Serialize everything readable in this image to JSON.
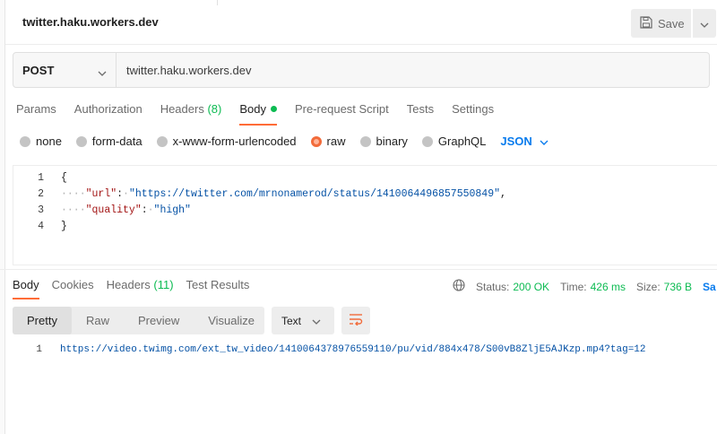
{
  "tab": {
    "title": "twitter.haku.workers.dev"
  },
  "toolbar": {
    "save_label": "Save"
  },
  "request": {
    "method": "POST",
    "url": "twitter.haku.workers.dev"
  },
  "request_tabs": {
    "params": "Params",
    "authorization": "Authorization",
    "headers": "Headers",
    "headers_count": "(8)",
    "body": "Body",
    "prerequest": "Pre-request Script",
    "tests": "Tests",
    "settings": "Settings"
  },
  "body_types": {
    "none": "none",
    "form_data": "form-data",
    "urlencoded": "x-www-form-urlencoded",
    "raw": "raw",
    "binary": "binary",
    "graphql": "GraphQL",
    "format": "JSON"
  },
  "editor": {
    "line_numbers": [
      "1",
      "2",
      "3",
      "4"
    ],
    "open_brace": "{",
    "close_brace": "}",
    "url_key": "\"url\"",
    "url_value": "\"https://twitter.com/mrnonamerod/status/1410064496857550849\"",
    "quality_key": "\"quality\"",
    "quality_value": "\"high\""
  },
  "response_tabs": {
    "body": "Body",
    "cookies": "Cookies",
    "headers": "Headers",
    "headers_count": "(11)",
    "test_results": "Test Results"
  },
  "response_status": {
    "status_label": "Status:",
    "status_value": "200 OK",
    "time_label": "Time:",
    "time_value": "426 ms",
    "size_label": "Size:",
    "size_value": "736 B",
    "save_link": "Sa"
  },
  "response_view": {
    "pretty": "Pretty",
    "raw": "Raw",
    "preview": "Preview",
    "visualize": "Visualize",
    "format": "Text"
  },
  "response_body": {
    "line_number": "1",
    "content": "https://video.twimg.com/ext_tw_video/1410064378976559110/pu/vid/884x478/S00vB8ZljE5AJKzp.mp4?tag=12"
  },
  "colors": {
    "accent": "#ff6c37",
    "success": "#0cbb52",
    "link": "#097bed"
  }
}
